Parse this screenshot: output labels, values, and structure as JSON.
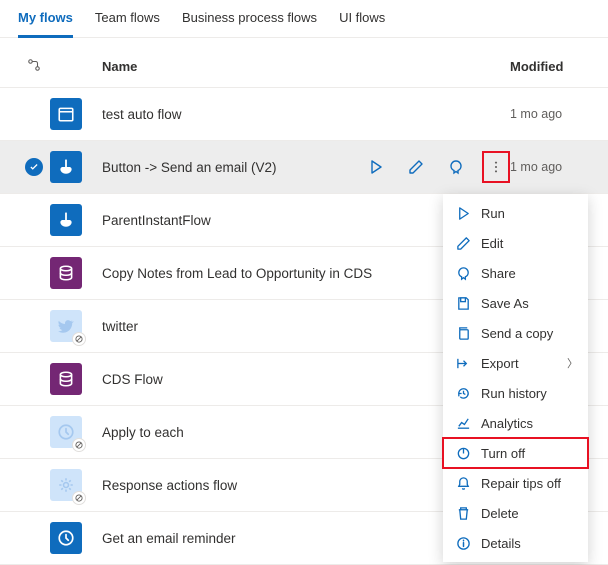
{
  "tabs": {
    "my_flows": "My flows",
    "team_flows": "Team flows",
    "bpf": "Business process flows",
    "ui_flows": "UI flows"
  },
  "header": {
    "name": "Name",
    "modified": "Modified"
  },
  "rows": [
    {
      "name": "test auto flow",
      "modified": "1 mo ago",
      "color": "#0f6cbd",
      "icon": "calendar",
      "dim": false
    },
    {
      "name": "Button -> Send an email (V2)",
      "modified": "1 mo ago",
      "color": "#0f6cbd",
      "icon": "touch",
      "dim": false,
      "selected": true
    },
    {
      "name": "ParentInstantFlow",
      "modified": "",
      "color": "#0f6cbd",
      "icon": "touch",
      "dim": false
    },
    {
      "name": "Copy Notes from Lead to Opportunity in CDS",
      "modified": "",
      "color": "#742774",
      "icon": "db",
      "dim": false
    },
    {
      "name": "twitter",
      "modified": "",
      "color": "#cfe4fa",
      "icon": "twitter",
      "dim": true
    },
    {
      "name": "CDS Flow",
      "modified": "",
      "color": "#742774",
      "icon": "db",
      "dim": false
    },
    {
      "name": "Apply to each",
      "modified": "",
      "color": "#cfe4fa",
      "icon": "clock",
      "dim": true
    },
    {
      "name": "Response actions flow",
      "modified": "",
      "color": "#cfe4fa",
      "icon": "gear",
      "dim": true
    },
    {
      "name": "Get an email reminder",
      "modified": "",
      "color": "#0f6cbd",
      "icon": "clock",
      "dim": false
    }
  ],
  "menu": {
    "run": "Run",
    "edit": "Edit",
    "share": "Share",
    "save_as": "Save As",
    "send_copy": "Send a copy",
    "export": "Export",
    "run_history": "Run history",
    "analytics": "Analytics",
    "turn_off": "Turn off",
    "repair_tips": "Repair tips off",
    "delete": "Delete",
    "details": "Details"
  }
}
